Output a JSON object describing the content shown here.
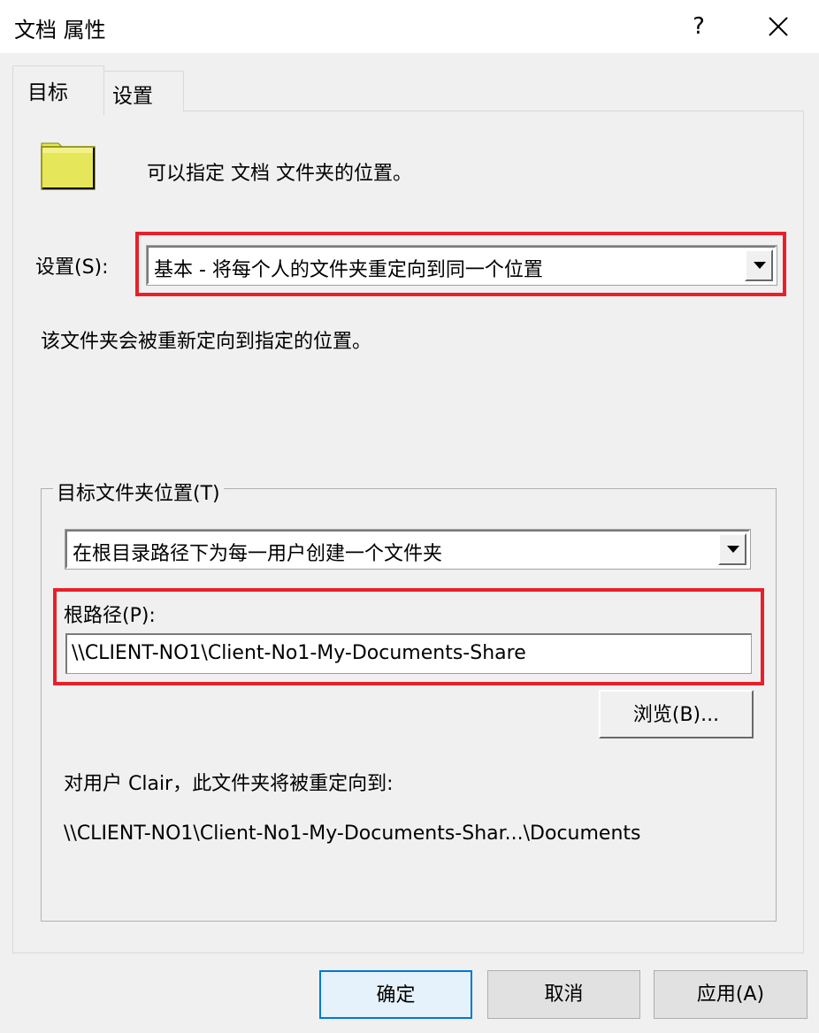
{
  "window": {
    "title": "文档 属性",
    "help_symbol": "?"
  },
  "tabs": [
    {
      "label": "目标",
      "selected": true
    },
    {
      "label": "设置",
      "selected": false
    }
  ],
  "target": {
    "description": "可以指定 文档 文件夹的位置。",
    "setting_label": "设置(S):",
    "setting_value": "基本 - 将每个人的文件夹重定向到同一个位置",
    "setting_info": "该文件夹会被重新定向到指定的位置。",
    "group_title": "目标文件夹位置(T)",
    "location_option": "在根目录路径下为每一用户创建一个文件夹",
    "root_path_label": "根路径(P):",
    "root_path_value": "\\\\CLIENT-NO1\\Client-No1-My-Documents-Share",
    "browse_label": "浏览(B)...",
    "redirect_label": "对用户 Clair，此文件夹将被重定向到:",
    "redirect_path": "\\\\CLIENT-NO1\\Client-No1-My-Documents-Shar...\\Documents"
  },
  "footer": {
    "ok_label": "确定",
    "cancel_label": "取消",
    "apply_label": "应用(A)"
  },
  "colors": {
    "highlight_red": "#e8202a",
    "default_button_border": "#0078d7",
    "folder_yellow": "#e6e65a"
  },
  "icons": {
    "folder": "folder-icon",
    "close": "close-icon",
    "dropdown": "chevron-down-icon"
  }
}
